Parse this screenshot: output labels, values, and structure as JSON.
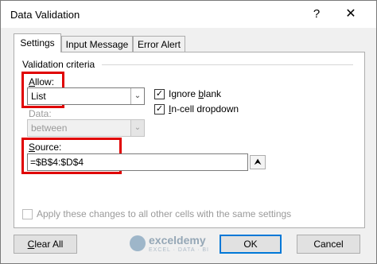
{
  "window": {
    "title": "Data Validation",
    "help_glyph": "?",
    "close_glyph": "✕"
  },
  "tabs": [
    {
      "label": "Settings",
      "active": true
    },
    {
      "label": "Input Message",
      "active": false
    },
    {
      "label": "Error Alert",
      "active": false
    }
  ],
  "settings": {
    "group_label": "Validation criteria",
    "allow": {
      "label_prefix": "",
      "label_hotkey": "A",
      "label_rest": "llow:",
      "value": "List"
    },
    "ignore_blank": {
      "label_prefix": "Ignore ",
      "label_hotkey": "b",
      "label_rest": "lank",
      "checked": true
    },
    "incell_dropdown": {
      "label_prefix": "",
      "label_hotkey": "I",
      "label_rest": "n-cell dropdown",
      "checked": true
    },
    "data": {
      "label": "Data:",
      "value": "between"
    },
    "source": {
      "label_prefix": "",
      "label_hotkey": "S",
      "label_rest": "ource:",
      "value": "=$B$4:$D$4"
    },
    "apply_all": {
      "label": "Apply these changes to all other cells with the same settings",
      "checked": false
    }
  },
  "buttons": {
    "clear_all_hotkey": "C",
    "clear_all_rest": "lear All",
    "ok": "OK",
    "cancel": "Cancel"
  },
  "watermark": {
    "name": "exceldemy",
    "tagline": "EXCEL · DATA · BI"
  },
  "icons": {
    "dropdown": "chevron-down-icon",
    "collapse": "collapse-dialog-icon",
    "check": "checkmark-icon"
  },
  "colors": {
    "highlight": "#e00000",
    "default_button_border": "#0078d7"
  }
}
